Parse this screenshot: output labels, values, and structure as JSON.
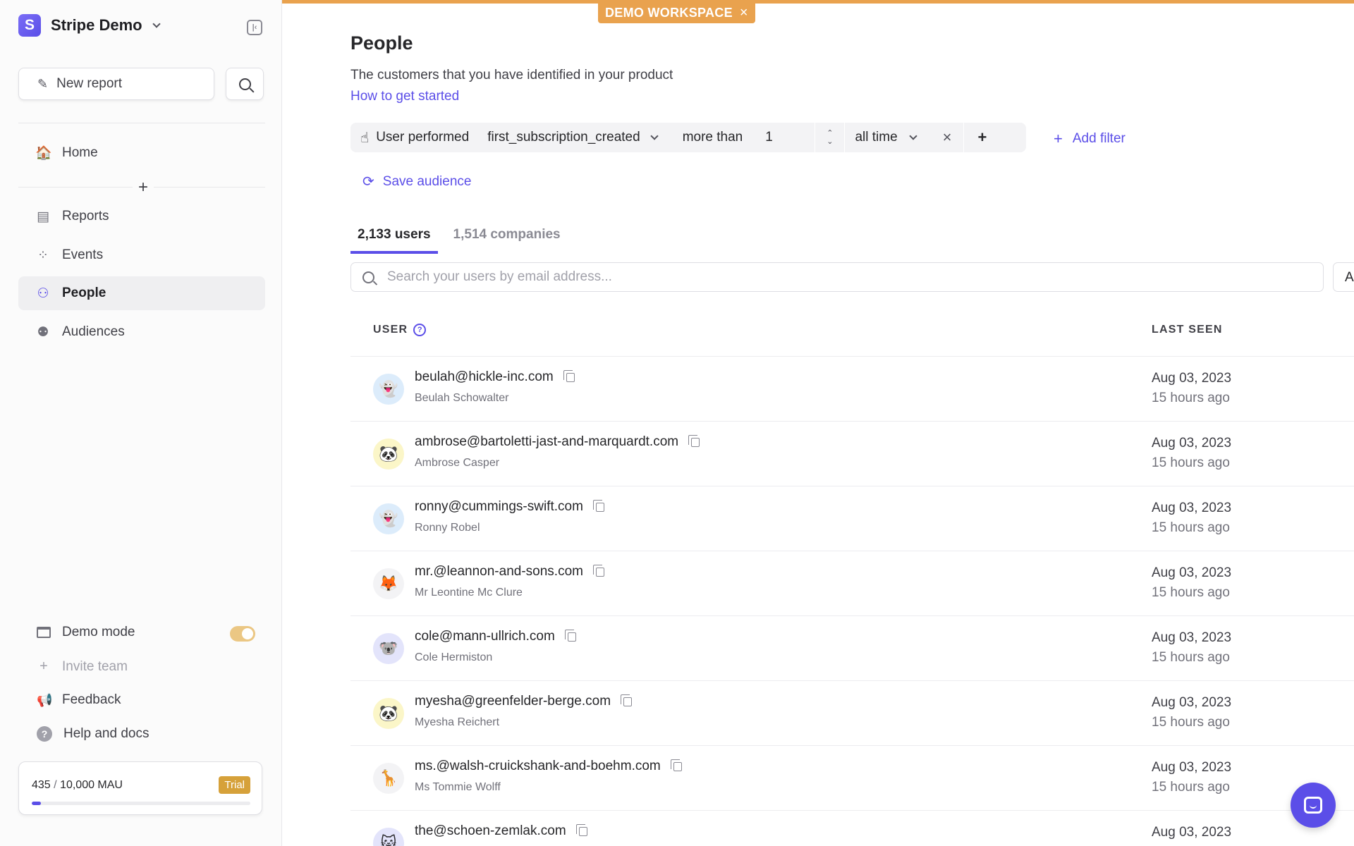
{
  "workspace": {
    "name": "Stripe Demo",
    "logo_letter": "S"
  },
  "sidebar": {
    "new_report": "New report",
    "nav": [
      {
        "label": "Home",
        "icon": "house-icon"
      },
      {
        "label": "Reports",
        "icon": "presentation-chart-icon"
      },
      {
        "label": "Events",
        "icon": "cursor-click-icon"
      },
      {
        "label": "People",
        "icon": "users-icon"
      },
      {
        "label": "Audiences",
        "icon": "user-group-icon"
      }
    ],
    "bottom": {
      "demo_mode": "Demo mode",
      "invite_team": "Invite team",
      "feedback": "Feedback",
      "help": "Help and docs"
    },
    "mau": {
      "used": "435",
      "limit": "10,000 MAU",
      "badge": "Trial",
      "fraction": 0.0435
    }
  },
  "banner": {
    "label": "DEMO WORKSPACE",
    "close": "×"
  },
  "page": {
    "title": "People",
    "subtitle": "The customers that you have identified in your product",
    "link": "How to get started"
  },
  "filter": {
    "condition": "User performed",
    "event": "first_subscription_created",
    "operator": "more than",
    "count": "1",
    "range": "all time",
    "remove": "×",
    "add": "+",
    "add_filter": "Add filter"
  },
  "save_audience": "Save audience",
  "tabs": [
    {
      "label": "2,133 users"
    },
    {
      "label": "1,514 companies"
    }
  ],
  "search": {
    "placeholder": "Search your users by email address...",
    "extra_button": "A"
  },
  "table": {
    "columns": {
      "user": "USER",
      "last_seen": "LAST SEEN"
    },
    "rows": [
      {
        "email": "beulah@hickle-inc.com",
        "name": "Beulah Schowalter",
        "date": "Aug 03, 2023",
        "ago": "15 hours ago",
        "avatar": "👻",
        "avatar_bg": "#dcecfb"
      },
      {
        "email": "ambrose@bartoletti-jast-and-marquardt.com",
        "name": "Ambrose Casper",
        "date": "Aug 03, 2023",
        "ago": "15 hours ago",
        "avatar": "🐼",
        "avatar_bg": "#fbf6c8"
      },
      {
        "email": "ronny@cummings-swift.com",
        "name": "Ronny Robel",
        "date": "Aug 03, 2023",
        "ago": "15 hours ago",
        "avatar": "👻",
        "avatar_bg": "#dcecfb"
      },
      {
        "email": "mr.@leannon-and-sons.com",
        "name": "Mr Leontine Mc Clure",
        "date": "Aug 03, 2023",
        "ago": "15 hours ago",
        "avatar": "🦊",
        "avatar_bg": "#f3f3f5"
      },
      {
        "email": "cole@mann-ullrich.com",
        "name": "Cole Hermiston",
        "date": "Aug 03, 2023",
        "ago": "15 hours ago",
        "avatar": "🐨",
        "avatar_bg": "#e3e4fb"
      },
      {
        "email": "myesha@greenfelder-berge.com",
        "name": "Myesha Reichert",
        "date": "Aug 03, 2023",
        "ago": "15 hours ago",
        "avatar": "🐼",
        "avatar_bg": "#fbf6c8"
      },
      {
        "email": "ms.@walsh-cruickshank-and-boehm.com",
        "name": "Ms Tommie Wolff",
        "date": "Aug 03, 2023",
        "ago": "15 hours ago",
        "avatar": "🦒",
        "avatar_bg": "#f3f3f5"
      },
      {
        "email": "the@schoen-zemlak.com",
        "name": "",
        "date": "Aug 03, 2023",
        "ago": "",
        "avatar": "🐱",
        "avatar_bg": "#e3e4fb"
      }
    ]
  },
  "colors": {
    "accent": "#5b4ee8",
    "banner": "#e9a24e",
    "trial": "#d6a13a"
  }
}
